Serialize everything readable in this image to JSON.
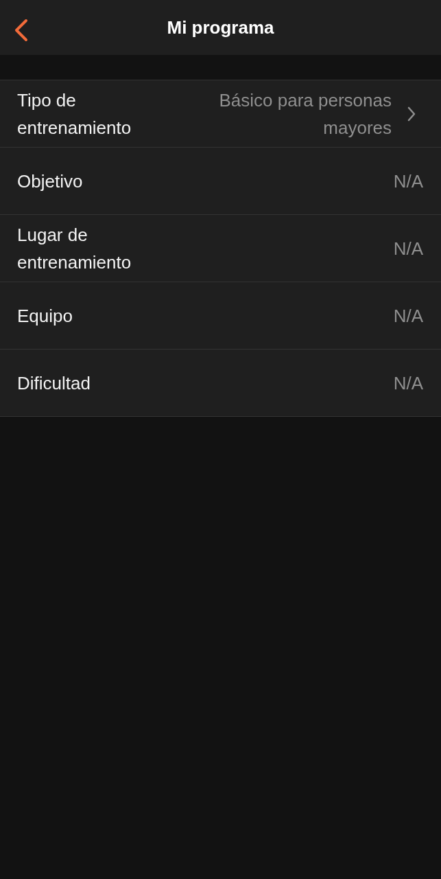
{
  "header": {
    "title": "Mi programa"
  },
  "rows": [
    {
      "kind": "disclosure",
      "label": "Tipo de entrenamiento",
      "value": "Básico para personas mayores"
    },
    {
      "kind": "plain",
      "label": "Objetivo",
      "value": "N/A"
    },
    {
      "kind": "plain",
      "label": "Lugar de entrenamiento",
      "value": "N/A"
    },
    {
      "kind": "plain",
      "label": "Equipo",
      "value": "N/A"
    },
    {
      "kind": "plain",
      "label": "Dificultad",
      "value": "N/A"
    }
  ]
}
